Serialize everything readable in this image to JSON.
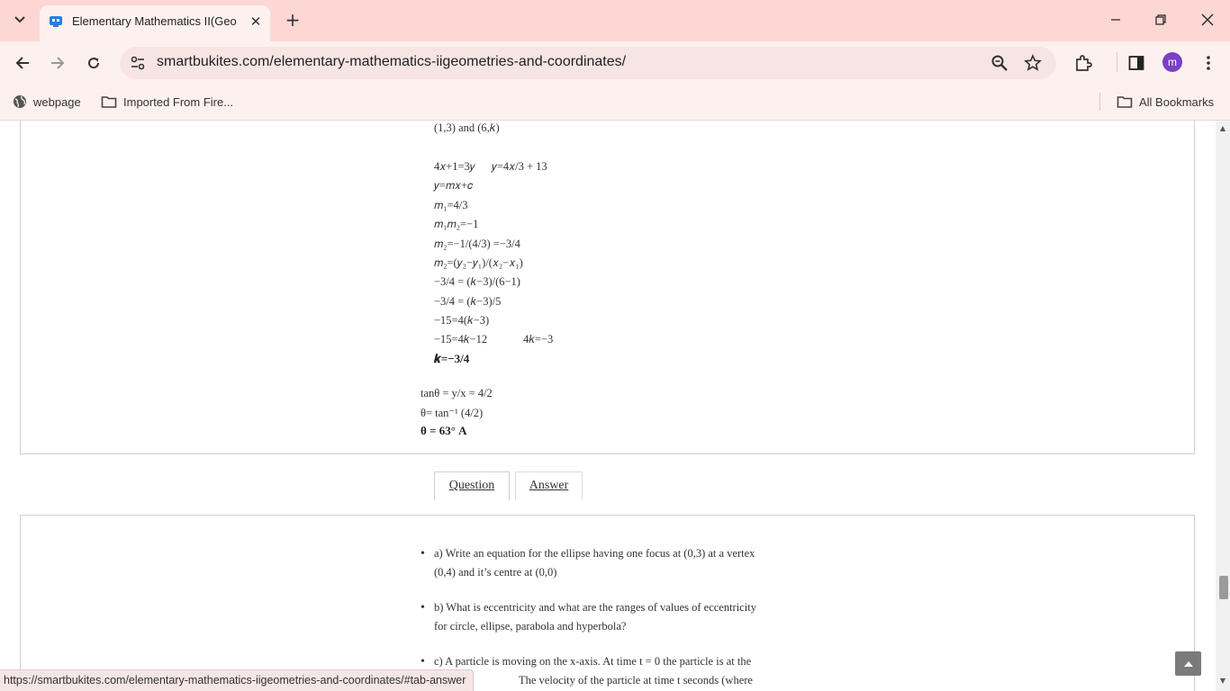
{
  "browser": {
    "tab_title": "Elementary Mathematics II(Geo",
    "url": "smartbukites.com/elementary-mathematics-iigeometries-and-coordinates/",
    "profile_initial": "m",
    "bookmarks": [
      "webpage",
      "Imported From Fire...",
      "All Bookmarks"
    ],
    "status_url": "https://smartbukites.com/elementary-mathematics-iigeometries-and-coordinates/#tab-answer"
  },
  "answer": {
    "lines": [
      "(1,3) and (6,𝑘)",
      "4𝑥+1=3𝑦",
      "𝑦=4𝑥/3 + 13",
      "𝑦=𝑚𝑥+𝑐",
      "𝑚₁=4/3",
      "𝑚₁𝑚₂=−1",
      "𝑚₂=−1/(4/3) =−3/4",
      "𝑚₂=(𝑦₂−𝑦₁)/(𝑥₂−𝑥₁)",
      "−3/4 = (𝑘−3)/(6−1)",
      "−3/4 = (𝑘−3)/5",
      "−15=4(𝑘−3)",
      "−15=4𝑘−12",
      "4𝑘=−3",
      "𝒌=−3/4",
      "tanθ = y/x = 4/2",
      "θ= tan⁻¹ (4/2)",
      "θ = 63°   A"
    ]
  },
  "tabs": {
    "question": "Question",
    "answer": "Answer"
  },
  "question": {
    "a": [
      "a) Write an equation for the ellipse having one focus at (0,3) at a vertex",
      "(0,4) and it’s centre at (0,0)"
    ],
    "b": [
      "b) What is eccentricity and what are the ranges of values of eccentricity",
      "for circle, ellipse, parabola and hyperbola?"
    ],
    "c": [
      "c) A particle is moving on the x-axis. At time t = 0   the particle is at the",
      "The velocity of the particle at time t seconds (where"
    ]
  }
}
